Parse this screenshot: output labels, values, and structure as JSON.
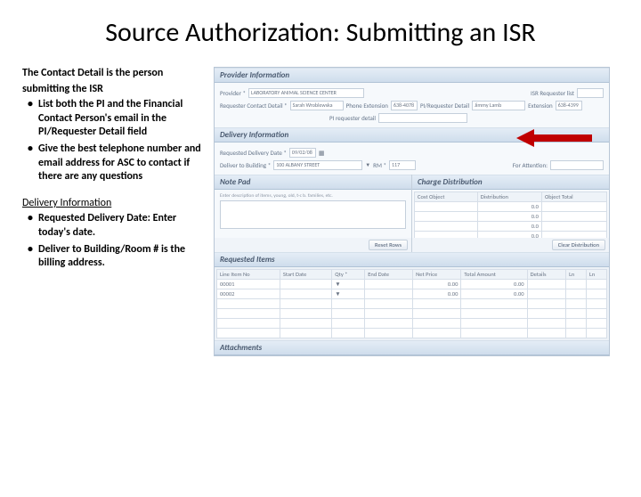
{
  "title": "Source Authorization: Submitting an ISR",
  "left": {
    "intro1": "The Contact Detail is the person",
    "intro2": "submitting the ISR",
    "b1": "List both the PI and the Financial Contact Person's email in the PI/Requester Detail field",
    "b2": "Give the best telephone number and email address for ASC to contact if there are any questions",
    "section2": "Delivery Information",
    "b3": "Requested Delivery Date: Enter today's date.",
    "b4": "Deliver to Building/Room # is the billing address."
  },
  "app": {
    "provider_bar": "Provider Information",
    "provider_lbl": "Provider *",
    "provider_val": "LABORATORY ANIMAL SCIENCE CENTER",
    "isr_lbl": "ISR Requester list",
    "contact_lbl": "Requester Contact Detail *",
    "contact_val": "Sarah Wroblewska",
    "phone_lbl": "Phone Extension",
    "phone_val": "638-4078",
    "pi_lbl": "PI/Requester Detail",
    "pi_val": "Jimmy Lamb",
    "ext_lbl": "Extension",
    "ext_val": "638-4399",
    "pi_detail_lbl": "PI requester detail",
    "delivery_bar": "Delivery Information",
    "date_lbl": "Requested Delivery Date *",
    "date_val": "09/02/08",
    "bldg_lbl": "Deliver to Building *",
    "bldg_val": "100 ALBANY STREET",
    "room_lbl": "RM *",
    "room_val": "117",
    "floor_lbl": "For Attention:",
    "notepad_bar": "Note Pad",
    "notepad_hint": "Enter description of items, young, old, t-c b. families, etc.",
    "charge_bar": "Charge Distribution",
    "charge_h1": "Cost Object",
    "charge_h2": "Distribution",
    "charge_h3": "Object Total",
    "charge_rows": [
      {
        "v": "0.0"
      },
      {
        "v": "0.0"
      },
      {
        "v": "0.0"
      },
      {
        "v": "0.0"
      }
    ],
    "reset_btn": "Reset Rows",
    "clear_btn": "Clear Distribution",
    "req_bar": "Requested Items",
    "req_headers": [
      "Line Item No",
      "Start Date",
      "Qty *",
      "End Date",
      "Net Price",
      "Total Amount",
      "Details",
      "Ln",
      "Ln"
    ],
    "req_rows": [
      {
        "c1": "00001",
        "price": "0.00",
        "total": "0.00",
        "det": ""
      },
      {
        "c1": "00002",
        "price": "0.00",
        "total": "0.00",
        "det": ""
      }
    ],
    "attach_bar": "Attachments"
  }
}
